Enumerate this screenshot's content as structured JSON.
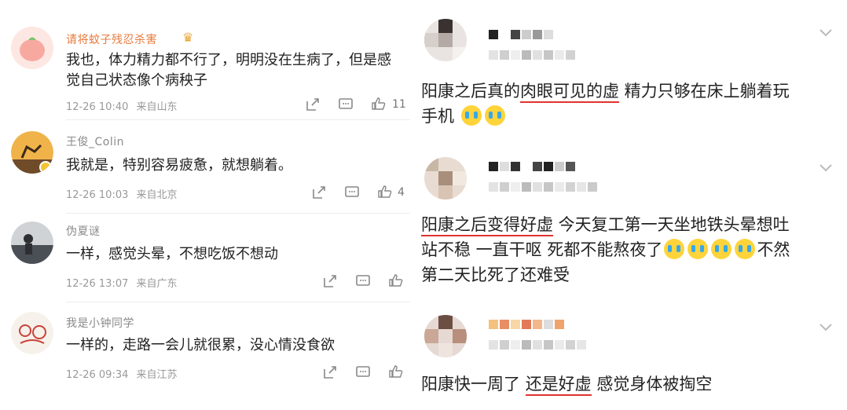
{
  "left": {
    "comments": [
      {
        "username": "请将蚊子残忍杀害",
        "text": "我也，体力精力都不行了，明明没在生病了，但是感觉自己状态像个病秧子",
        "date": "12-26 10:40",
        "source": "来自山东",
        "likes": "11"
      },
      {
        "username": "王俊_Colin",
        "text": "我就是，特别容易疲惫，就想躺着。",
        "date": "12-26 10:03",
        "source": "来自北京",
        "likes": "4"
      },
      {
        "username": "伪夏谜",
        "text": "一样，感觉头晕，不想吃饭不想动",
        "date": "12-26 13:07",
        "source": "来自广东",
        "likes": ""
      },
      {
        "username": "我是小钟同学",
        "text": "一样的，走路一会儿就很累，没心情没食欲",
        "date": "12-26 09:34",
        "source": "来自江苏",
        "likes": ""
      }
    ]
  },
  "right": {
    "posts": [
      {
        "line1_a": "阳康之后真的",
        "line1_u": "肉眼可见的虚",
        "line1_b": " 精力只够在床上躺着玩",
        "line2": "手机"
      },
      {
        "line1_u": "阳康之后变得好虚",
        "line1_b": " 今天复工第一天坐地铁头晕想吐",
        "line2_a": "站不稳 一直干呕 死都不能熬夜了",
        "line2_b": "不然",
        "line3": "第二天比死了还难受"
      },
      {
        "line1_a": "阳康快一周了 ",
        "line1_u": "还是好虚",
        "line1_b": " 感觉身体被掏空"
      }
    ]
  },
  "icons": [
    "repost-icon",
    "comment-icon",
    "like-icon",
    "chevron-down-icon",
    "cry-emoji-icon"
  ],
  "colors": {
    "underline": "#e0332e",
    "meta": "#999999",
    "username": "#8a8a8a"
  }
}
